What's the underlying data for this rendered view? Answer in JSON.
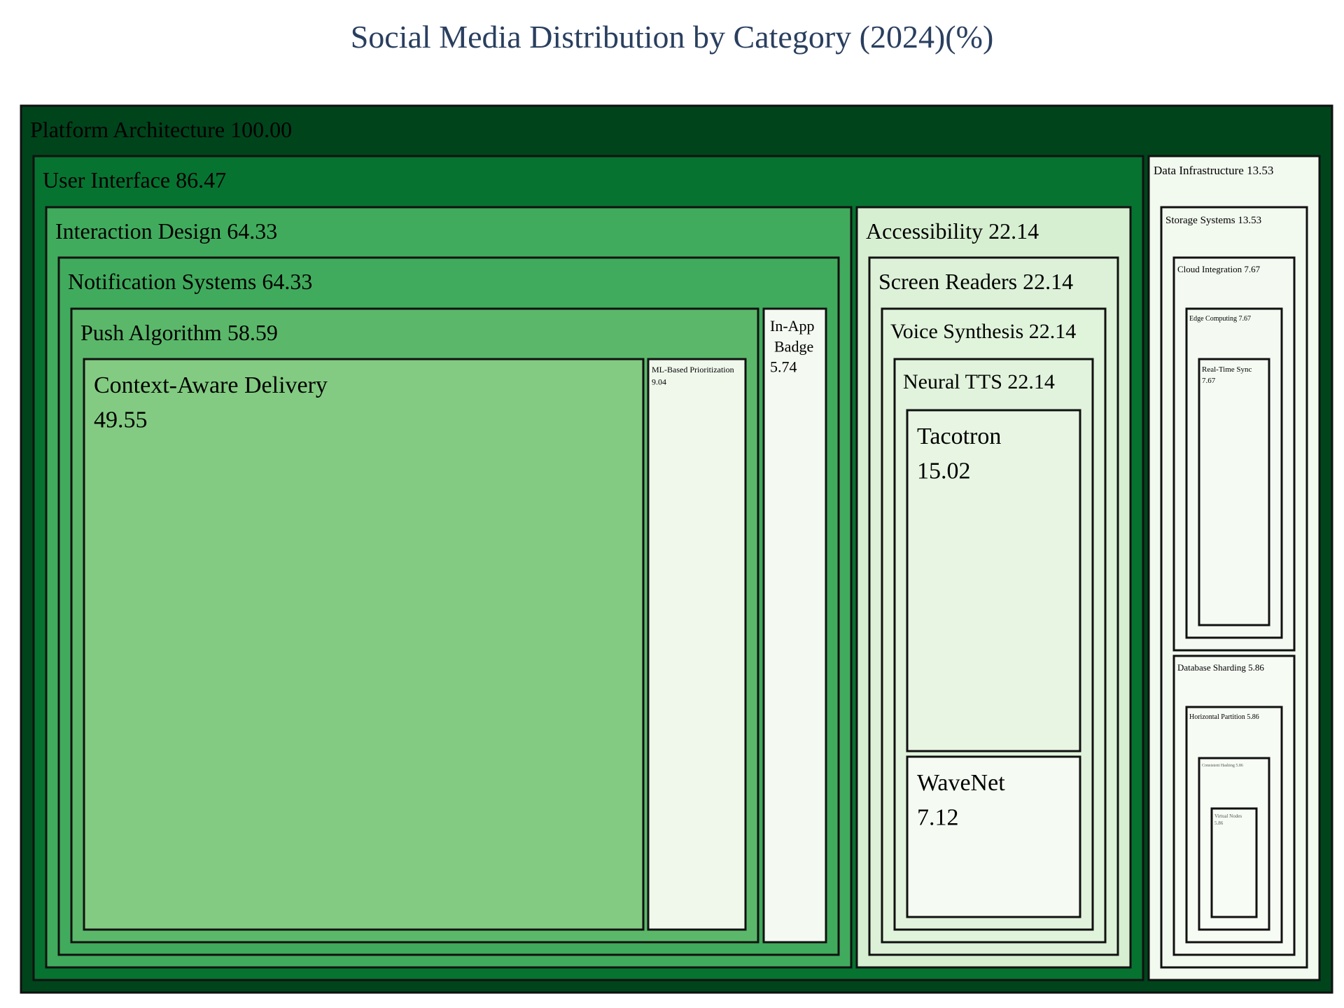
{
  "chart_data": {
    "type": "treemap",
    "title": "Social Media Distribution by Category (2024)(%)",
    "value_format": "%.2f",
    "colors": {
      "Platform Architecture": "#00441b",
      "User Interface": "#077331",
      "Interaction Design": "#41ab5d",
      "Notification Systems": "#41ab5d",
      "Push Algorithm": "#5bb86a",
      "Context-Aware Delivery": "#83cb82",
      "ML-Based Prioritization": "#f0f8ec",
      "In-App Badge": "#f4faf2",
      "Accessibility": "#d7efd1",
      "Screen Readers": "#dcf1d7",
      "Voice Synthesis": "#e0f3db",
      "Neural TTS": "#e1f3dc",
      "Tacotron": "#e7f5e2",
      "WaveNet": "#f5fbf3",
      "Data Infrastructure": "#f2f9ef",
      "Storage Systems": "#f2f9ef",
      "Cloud Integration": "#f4faf2",
      "Edge Computing": "#f4faf2",
      "Real-Time Sync": "#f5fbf3",
      "Database Sharding": "#f6fbf4",
      "Horizontal Partition": "#f6fbf4",
      "Consistent Hashing": "#f7fcf5",
      "Virtual Nodes": "#f7fcf5"
    },
    "root": {
      "name": "Platform Architecture",
      "value": 100.0,
      "children": [
        {
          "name": "User Interface",
          "value": 86.47,
          "children": [
            {
              "name": "Interaction Design",
              "value": 64.33,
              "children": [
                {
                  "name": "Notification Systems",
                  "value": 64.33,
                  "children": [
                    {
                      "name": "Push Algorithm",
                      "value": 58.59,
                      "children": [
                        {
                          "name": "Context-Aware Delivery",
                          "value": 49.55
                        },
                        {
                          "name": "ML-Based Prioritization",
                          "value": 9.04
                        }
                      ]
                    },
                    {
                      "name": "In-App Badge",
                      "value": 5.74
                    }
                  ]
                }
              ]
            },
            {
              "name": "Accessibility",
              "value": 22.14,
              "children": [
                {
                  "name": "Screen Readers",
                  "value": 22.14,
                  "children": [
                    {
                      "name": "Voice Synthesis",
                      "value": 22.14,
                      "children": [
                        {
                          "name": "Neural TTS",
                          "value": 22.14,
                          "children": [
                            {
                              "name": "Tacotron",
                              "value": 15.02
                            },
                            {
                              "name": "WaveNet",
                              "value": 7.12
                            }
                          ]
                        }
                      ]
                    }
                  ]
                }
              ]
            }
          ]
        },
        {
          "name": "Data Infrastructure",
          "value": 13.53,
          "children": [
            {
              "name": "Storage Systems",
              "value": 13.53,
              "children": [
                {
                  "name": "Cloud Integration",
                  "value": 7.67,
                  "children": [
                    {
                      "name": "Edge Computing",
                      "value": 7.67,
                      "children": [
                        {
                          "name": "Real-Time Sync",
                          "value": 7.67
                        }
                      ]
                    }
                  ]
                },
                {
                  "name": "Database Sharding",
                  "value": 5.86,
                  "children": [
                    {
                      "name": "Horizontal Partition",
                      "value": 5.86,
                      "children": [
                        {
                          "name": "Consistent Hashing",
                          "value": 5.86,
                          "children": [
                            {
                              "name": "Virtual Nodes",
                              "value": 5.86
                            }
                          ]
                        }
                      ]
                    }
                  ]
                }
              ]
            }
          ]
        }
      ]
    }
  }
}
